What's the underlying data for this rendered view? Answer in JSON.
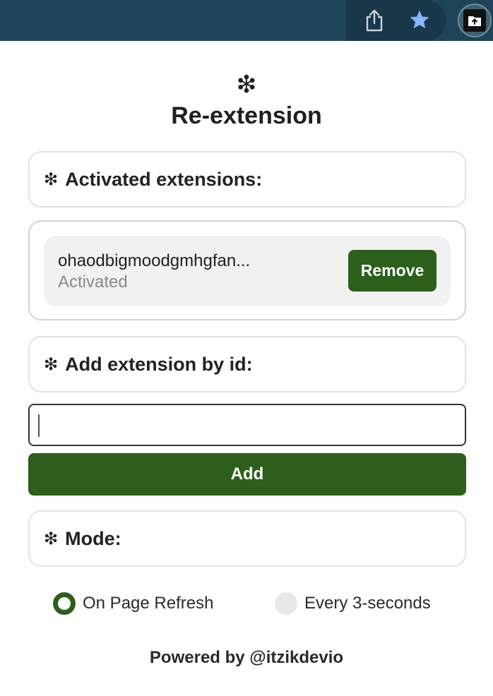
{
  "toolbar": {
    "icons": [
      "share-icon",
      "bookmark-star-icon",
      "extension-icon"
    ],
    "colors": {
      "bar": "#1e4457",
      "star": "#8ab4f8"
    }
  },
  "header": {
    "logo": "❇",
    "title": "Re-extension"
  },
  "activated": {
    "heading": "Activated extensions:",
    "items": [
      {
        "id": "ohaodbigmoodgmhgfan...",
        "status": "Activated",
        "button": "Remove"
      }
    ]
  },
  "add": {
    "heading": "Add extension by id:",
    "input_value": "",
    "button": "Add"
  },
  "mode": {
    "heading": "Mode:",
    "options": [
      {
        "label": "On Page Refresh",
        "selected": true
      },
      {
        "label": "Every 3-seconds",
        "selected": false
      }
    ]
  },
  "footer": {
    "text": "Powered by @itzikdevio"
  },
  "colors": {
    "accent": "#2d5f1c",
    "item_bg": "#f1f1f1",
    "status": "#8a8a8a"
  }
}
